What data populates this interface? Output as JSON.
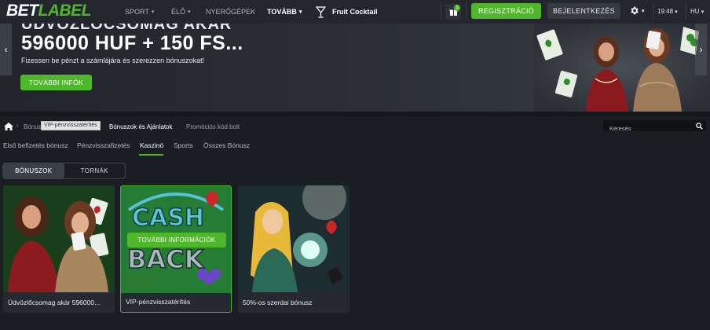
{
  "header": {
    "logo_part1": "BET",
    "logo_part2": "LABEL",
    "nav": [
      {
        "label": "SPORT",
        "has_chevron": true
      },
      {
        "label": "ÉLŐ",
        "has_chevron": true
      },
      {
        "label": "NYERŐGÉPEK",
        "has_chevron": false
      },
      {
        "label": "TOVÁBB",
        "has_chevron": true
      }
    ],
    "featured_game": "Fruit Cocktail",
    "gift_badge": "1",
    "register_label": "REGISZTRÁCIÓ",
    "login_label": "BEJELENTKEZÉS",
    "time": "19:48",
    "language": "HU"
  },
  "banner": {
    "title_top_partial": "ÜDVÖZLŐCSOMAG AKÁR",
    "title": "596000 HUF + 150 FS...",
    "subtitle": "Fizessen be pénzt a számlájára és szerezzen bónuszokat!",
    "button_label": "TOVÁBBI INFÓK"
  },
  "breadcrumb": {
    "items": [
      "Bónuszok",
      "Bónuszok és Ajánlatok",
      "Promóciós kód bolt"
    ],
    "tooltip": "VIP-pénzvisszatérítés"
  },
  "search": {
    "placeholder": "Keresés"
  },
  "tabs": [
    {
      "label": "Első befizetés bónusz",
      "active": false
    },
    {
      "label": "Pénzvisszafizetés",
      "active": false
    },
    {
      "label": "Kaszinó",
      "active": true
    },
    {
      "label": "Sports",
      "active": false
    },
    {
      "label": "Összes Bónusz",
      "active": false
    }
  ],
  "toggle": {
    "options": [
      "BÓNUSZOK",
      "TORNÁK"
    ],
    "active": "BÓNUSZOK"
  },
  "cards": [
    {
      "caption": "Üdvözlőcsomag akár 596000...",
      "highlighted": false
    },
    {
      "caption": "VIP-pénzvisszatérítés",
      "highlighted": true,
      "overlay_button": "TOVÁBBI INFORMÁCIÓK",
      "art_text_1": "CASH",
      "art_text_2": "BACK"
    },
    {
      "caption": "50%-os szerdai bónusz",
      "highlighted": false
    }
  ],
  "colors": {
    "accent": "#4fb82a",
    "background": "#1a1d22",
    "topbar": "#23272d"
  }
}
